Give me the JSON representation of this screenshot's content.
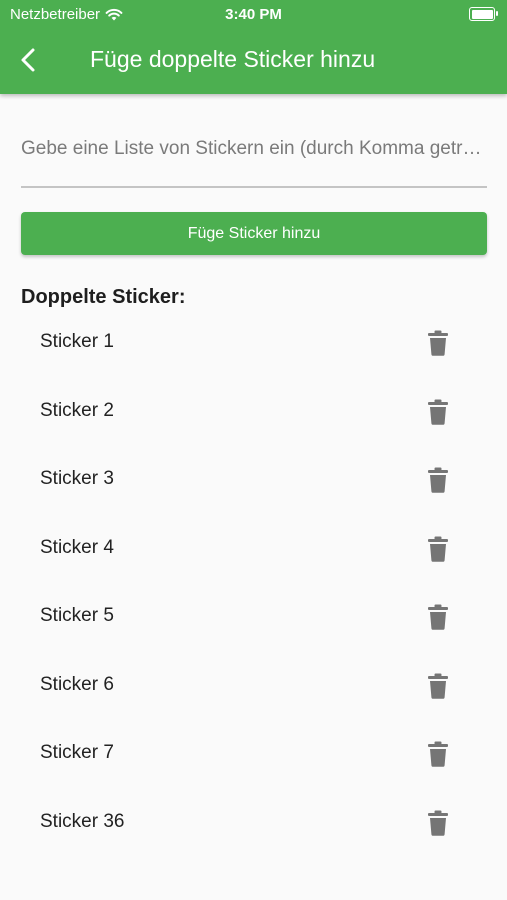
{
  "status_bar": {
    "carrier": "Netzbetreiber",
    "time": "3:40 PM"
  },
  "app_bar": {
    "title": "Füge doppelte Sticker hinzu"
  },
  "input": {
    "placeholder": "Gebe eine Liste von Stickern ein (durch Komma getrennt)",
    "value": ""
  },
  "add_button": {
    "label": "Füge Sticker hinzu"
  },
  "section": {
    "title": "Doppelte Sticker:"
  },
  "stickers": [
    {
      "label": "Sticker 1"
    },
    {
      "label": "Sticker 2"
    },
    {
      "label": "Sticker 3"
    },
    {
      "label": "Sticker 4"
    },
    {
      "label": "Sticker 5"
    },
    {
      "label": "Sticker 6"
    },
    {
      "label": "Sticker 7"
    },
    {
      "label": "Sticker 36"
    }
  ],
  "colors": {
    "primary": "#4caf50",
    "icon": "#757575",
    "background": "#fafafa"
  },
  "icons": {
    "back": "chevron-left-icon",
    "delete": "trash-icon"
  }
}
